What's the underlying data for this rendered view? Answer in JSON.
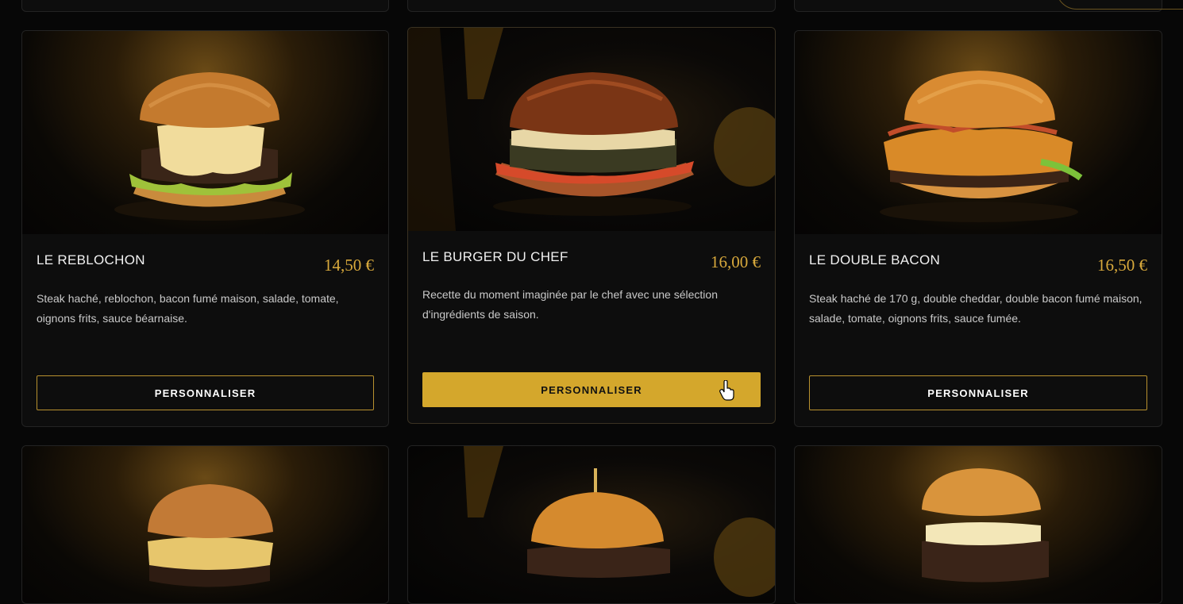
{
  "menu": {
    "items": [
      {
        "title": "LE REBLOCHON",
        "price": "14,50 €",
        "description": "Steak haché, reblochon, bacon fumé maison, salade, tomate, oignons frits, sauce béarnaise.",
        "button": "PERSONNALISER"
      },
      {
        "title": "LE BURGER DU CHEF",
        "price": "16,00 €",
        "description": "Recette du moment imaginée par le chef avec une sélection d'ingrédients de saison.",
        "button": "PERSONNALISER"
      },
      {
        "title": "LE DOUBLE BACON",
        "price": "16,50 €",
        "description": "Steak haché de 170 g, double cheddar, double bacon fumé maison, salade, tomate, oignons frits, sauce fumée.",
        "button": "PERSONNALISER"
      }
    ]
  },
  "colors": {
    "accent": "#d4a72c",
    "price": "#d8a93c",
    "background": "#070707",
    "card": "#0d0d0d"
  },
  "icons": {
    "cursor": "hand-pointer-icon"
  }
}
